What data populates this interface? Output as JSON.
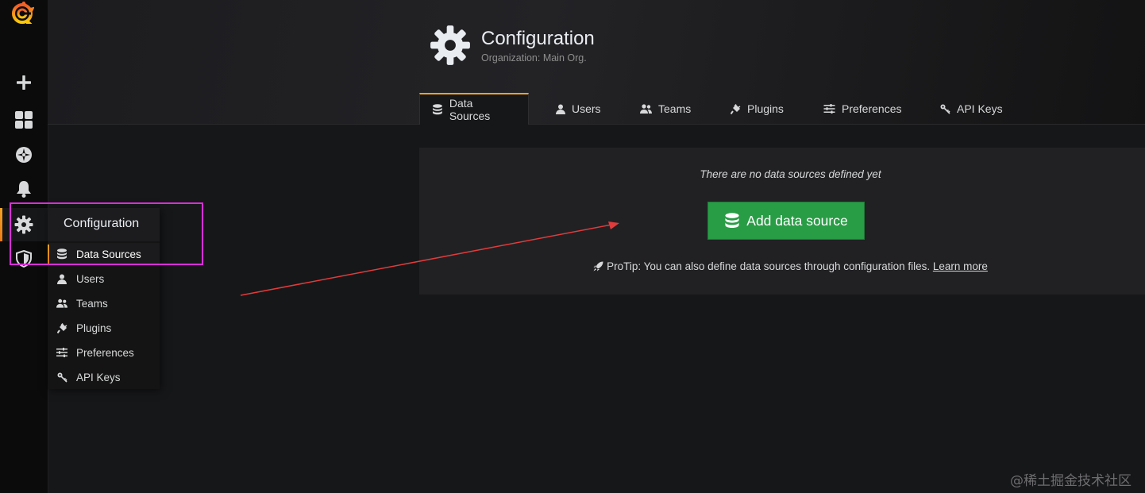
{
  "page": {
    "title": "Configuration",
    "subtitle": "Organization: Main Org."
  },
  "tabs": [
    {
      "label": "Data Sources",
      "icon": "database-icon",
      "active": true
    },
    {
      "label": "Users",
      "icon": "user-icon"
    },
    {
      "label": "Teams",
      "icon": "team-icon"
    },
    {
      "label": "Plugins",
      "icon": "plug-icon"
    },
    {
      "label": "Preferences",
      "icon": "sliders-icon"
    },
    {
      "label": "API Keys",
      "icon": "key-icon"
    }
  ],
  "sidemenu": {
    "items": [
      {
        "icon": "grafana-logo-icon"
      },
      {
        "icon": "plus-icon"
      },
      {
        "icon": "dashboards-icon"
      },
      {
        "icon": "explore-icon"
      },
      {
        "icon": "bell-icon"
      },
      {
        "icon": "gear-icon",
        "active": true
      },
      {
        "icon": "shield-icon"
      }
    ]
  },
  "dropdown": {
    "title": "Configuration",
    "items": [
      {
        "label": "Data Sources",
        "icon": "database-icon",
        "active": true
      },
      {
        "label": "Users",
        "icon": "user-icon"
      },
      {
        "label": "Teams",
        "icon": "team-icon"
      },
      {
        "label": "Plugins",
        "icon": "plug-icon"
      },
      {
        "label": "Preferences",
        "icon": "sliders-icon"
      },
      {
        "label": "API Keys",
        "icon": "key-icon"
      }
    ]
  },
  "empty_state": {
    "message": "There are no data sources defined yet",
    "button_label": "Add data source",
    "protip": "ProTip: You can also define data sources through configuration files.",
    "learn_more": "Learn more"
  },
  "watermark": "@稀土掘金技术社区",
  "colors": {
    "accent": "#f4a323",
    "primary_button": "#299c46",
    "highlight_box": "#d92ed9",
    "arrow": "#e23b3b"
  }
}
